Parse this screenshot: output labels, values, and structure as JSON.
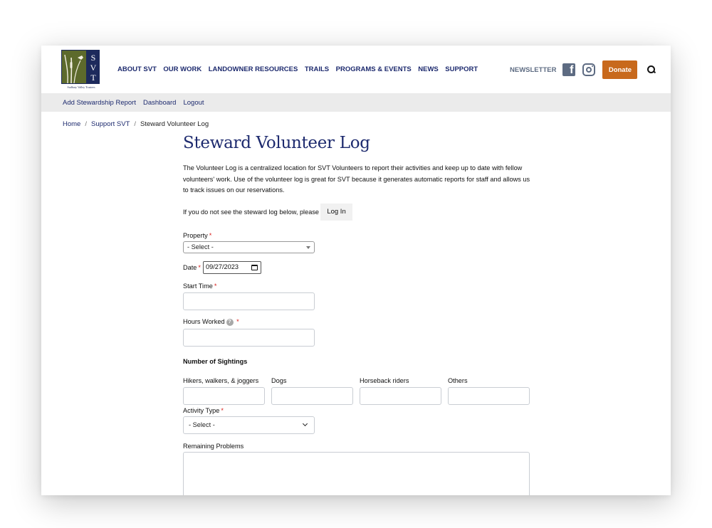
{
  "header": {
    "logo_letters": [
      "S",
      "V",
      "T"
    ],
    "logo_caption": "Sudbury Valley Trustees",
    "nav": [
      "ABOUT SVT",
      "OUR WORK",
      "LANDOWNER RESOURCES",
      "TRAILS",
      "PROGRAMS & EVENTS",
      "NEWS",
      "SUPPORT"
    ],
    "newsletter": "NEWSLETTER",
    "facebook_glyph": "f",
    "donate": "Donate",
    "accent_color": "#c8691c",
    "brand_color": "#1d2a6e"
  },
  "subnav": [
    "Add Stewardship Report",
    "Dashboard",
    "Logout"
  ],
  "breadcrumb": {
    "items": [
      "Home",
      "Support SVT"
    ],
    "separator": "/",
    "current": "Steward Volunteer Log"
  },
  "main": {
    "title": "Steward Volunteer Log",
    "intro": "The Volunteer Log is a centralized location for SVT Volunteers to report their activities and keep up to date with fellow volunteers' work. Use of the volunteer log is great for SVT because it generates automatic reports for staff and allows us to track issues on our reservations.",
    "login_prompt": "If you do not see the steward log below, please",
    "login_button": "Log In"
  },
  "form": {
    "required_mark": "*",
    "property": {
      "label": "Property",
      "value": "- Select -"
    },
    "date": {
      "label": "Date",
      "value": "09/27/2023"
    },
    "start_time": {
      "label": "Start Time",
      "value": ""
    },
    "hours_worked": {
      "label": "Hours Worked",
      "help": "?",
      "value": ""
    },
    "sightings": {
      "title": "Number of Sightings",
      "fields": [
        {
          "label": "Hikers, walkers, & joggers",
          "value": ""
        },
        {
          "label": "Dogs",
          "value": ""
        },
        {
          "label": "Horseback riders",
          "value": ""
        },
        {
          "label": "Others",
          "value": ""
        }
      ]
    },
    "activity_type": {
      "label": "Activity Type",
      "value": "- Select -"
    },
    "remaining_problems": {
      "label": "Remaining Problems",
      "value": ""
    }
  }
}
